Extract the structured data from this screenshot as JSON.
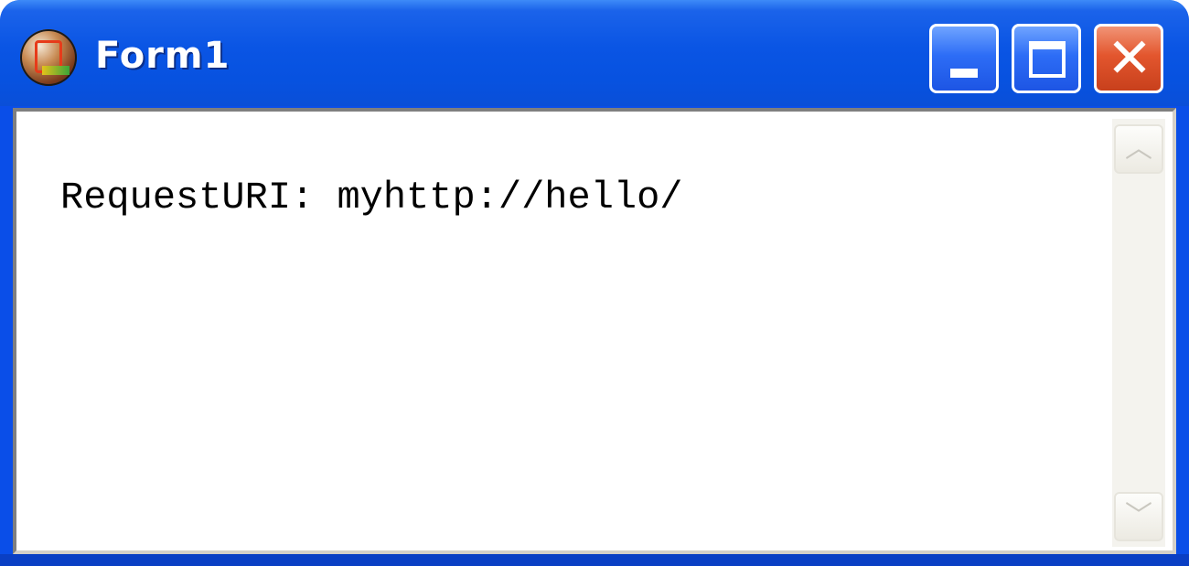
{
  "window": {
    "title": "Form1",
    "accent_color": "#0a4ee8",
    "close_color": "#e3562e",
    "icon": "delphi-app-icon"
  },
  "caption_buttons": {
    "minimize_icon": "minimize-icon",
    "maximize_icon": "maximize-icon",
    "close_icon": "close-icon",
    "close_glyph": "✕"
  },
  "memo": {
    "text": "RequestURI: myhttp://hello/"
  },
  "scrollbar": {
    "up_glyph": "︿",
    "down_glyph": "﹀"
  }
}
